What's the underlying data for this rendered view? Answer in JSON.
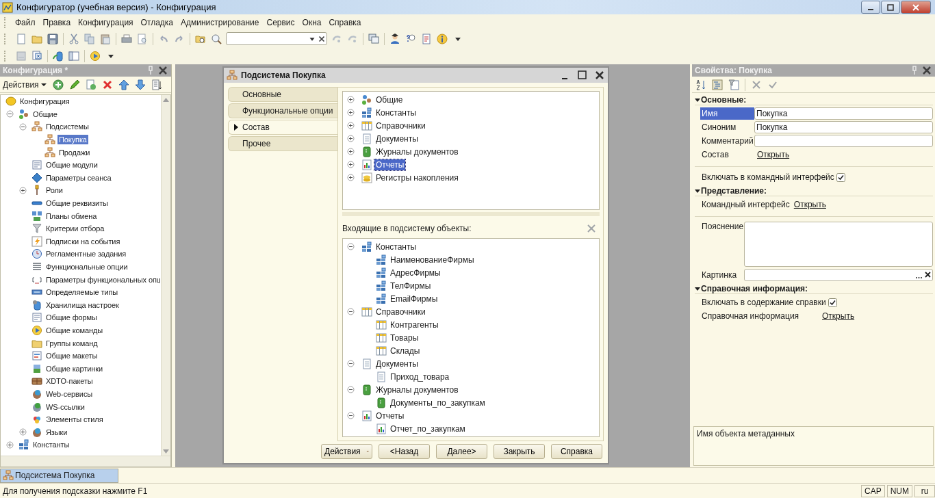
{
  "window": {
    "title": "Конфигуратор (учебная версия) - Конфигурация"
  },
  "menu": [
    "Файл",
    "Правка",
    "Конфигурация",
    "Отладка",
    "Администрирование",
    "Сервис",
    "Окна",
    "Справка"
  ],
  "config_panel": {
    "title": "Конфигурация *",
    "actions": "Действия",
    "tree": [
      {
        "label": "Конфигурация",
        "selected": false,
        "children": [
          {
            "label": "Общие",
            "expanded": true,
            "selected": false,
            "children": [
              {
                "label": "Подсистемы",
                "expanded": true,
                "selected": false,
                "children": [
                  {
                    "label": "Покупка",
                    "selected": true
                  },
                  {
                    "label": "Продажи",
                    "selected": false
                  }
                ]
              },
              {
                "label": "Общие модули",
                "selected": false
              },
              {
                "label": "Параметры сеанса",
                "selected": false
              },
              {
                "label": "Роли",
                "expanded": false,
                "selected": false
              },
              {
                "label": "Общие реквизиты",
                "selected": false
              },
              {
                "label": "Планы обмена",
                "selected": false
              },
              {
                "label": "Критерии отбора",
                "selected": false
              },
              {
                "label": "Подписки на события",
                "selected": false
              },
              {
                "label": "Регламентные задания",
                "selected": false
              },
              {
                "label": "Функциональные опции",
                "selected": false
              },
              {
                "label": "Параметры функциональных опц",
                "selected": false
              },
              {
                "label": "Определяемые типы",
                "selected": false
              },
              {
                "label": "Хранилища настроек",
                "selected": false
              },
              {
                "label": "Общие формы",
                "selected": false
              },
              {
                "label": "Общие команды",
                "selected": false
              },
              {
                "label": "Группы команд",
                "selected": false
              },
              {
                "label": "Общие макеты",
                "selected": false
              },
              {
                "label": "Общие картинки",
                "selected": false
              },
              {
                "label": "XDTO-пакеты",
                "selected": false
              },
              {
                "label": "Web-сервисы",
                "selected": false
              },
              {
                "label": "WS-ссылки",
                "selected": false
              },
              {
                "label": "Элементы стиля",
                "selected": false
              },
              {
                "label": "Языки",
                "expanded": false,
                "selected": false
              }
            ]
          },
          {
            "label": "Константы",
            "expanded": false,
            "selected": false
          }
        ]
      }
    ]
  },
  "dialog": {
    "title": "Подсистема Покупка",
    "tabs": [
      {
        "label": "Основные",
        "selected": false
      },
      {
        "label": "Функциональные опции",
        "selected": false
      },
      {
        "label": "Состав",
        "selected": true
      },
      {
        "label": "Прочее",
        "selected": false
      }
    ],
    "objects_tree": [
      {
        "label": "Общие",
        "expanded": false,
        "selected": false
      },
      {
        "label": "Константы",
        "expanded": false,
        "selected": false
      },
      {
        "label": "Справочники",
        "expanded": false,
        "selected": false
      },
      {
        "label": "Документы",
        "expanded": false,
        "selected": false
      },
      {
        "label": "Журналы документов",
        "expanded": false,
        "selected": false
      },
      {
        "label": "Отчеты",
        "expanded": false,
        "selected": true
      },
      {
        "label": "Регистры накопления",
        "expanded": false,
        "selected": false
      }
    ],
    "included_label": "Входящие в подсистему объекты:",
    "included_tree": [
      {
        "label": "Константы",
        "expanded": true,
        "selected": false,
        "children": [
          {
            "label": "НаименованиеФирмы",
            "selected": false
          },
          {
            "label": "АдресФирмы",
            "selected": false
          },
          {
            "label": "ТелФирмы",
            "selected": false
          },
          {
            "label": "EmailФирмы",
            "selected": false
          }
        ]
      },
      {
        "label": "Справочники",
        "expanded": true,
        "selected": false,
        "children": [
          {
            "label": "Контрагенты",
            "selected": false
          },
          {
            "label": "Товары",
            "selected": false
          },
          {
            "label": "Склады",
            "selected": false
          }
        ]
      },
      {
        "label": "Документы",
        "expanded": true,
        "selected": false,
        "children": [
          {
            "label": "Приход_товара",
            "selected": false
          }
        ]
      },
      {
        "label": "Журналы документов",
        "expanded": true,
        "selected": false,
        "children": [
          {
            "label": "Документы_по_закупкам",
            "selected": false
          }
        ]
      },
      {
        "label": "Отчеты",
        "expanded": true,
        "selected": false,
        "children": [
          {
            "label": "Отчет_по_закупкам",
            "selected": false
          }
        ]
      }
    ],
    "buttons": [
      {
        "label": "Действия",
        "kind": "menu"
      },
      {
        "label": "<Назад",
        "kind": "plain"
      },
      {
        "label": "Далее>",
        "kind": "plain"
      },
      {
        "label": "Закрыть",
        "kind": "plain"
      },
      {
        "label": "Справка",
        "kind": "plain"
      }
    ]
  },
  "properties": {
    "title": "Свойства: Покупка",
    "sections": [
      {
        "title": "Основные:",
        "expanded": true,
        "groups": [
          [
            {
              "kind": "field",
              "label": "Имя",
              "value": "Покупка",
              "selected": true
            },
            {
              "kind": "field",
              "label": "Синоним",
              "value": "Покупка",
              "selected": false
            },
            {
              "kind": "field",
              "label": "Комментарий",
              "selected": false
            },
            {
              "kind": "link",
              "label": "Состав",
              "link": "Открыть",
              "selected": false
            }
          ],
          [
            {
              "kind": "checkbox",
              "label": "Включать в командный интерфейс",
              "checked": true,
              "selected": false
            }
          ]
        ]
      },
      {
        "title": "Представление:",
        "expanded": true,
        "groups": [
          [
            {
              "kind": "link",
              "label": "Командный интерфейс",
              "link": "Открыть",
              "selected": false
            }
          ],
          [
            {
              "kind": "textarea",
              "label": "Пояснение",
              "selected": false
            },
            {
              "kind": "picker",
              "label": "Картинка",
              "selected": false
            }
          ]
        ]
      },
      {
        "title": "Справочная информация:",
        "expanded": true,
        "groups": [
          [
            {
              "kind": "checkbox",
              "label": "Включать в содержание справки",
              "checked": true,
              "selected": false
            },
            {
              "kind": "link",
              "label": "Справочная информация",
              "link": "Открыть",
              "selected": false
            }
          ]
        ]
      }
    ],
    "hint": "Имя объекта метаданных"
  },
  "windows_bar": [
    {
      "label": "Подсистема Покупка",
      "selected": true
    }
  ],
  "status": {
    "text": "Для получения подсказки нажмите F1",
    "indicators": [
      "CAP",
      "NUM",
      "ru"
    ]
  }
}
